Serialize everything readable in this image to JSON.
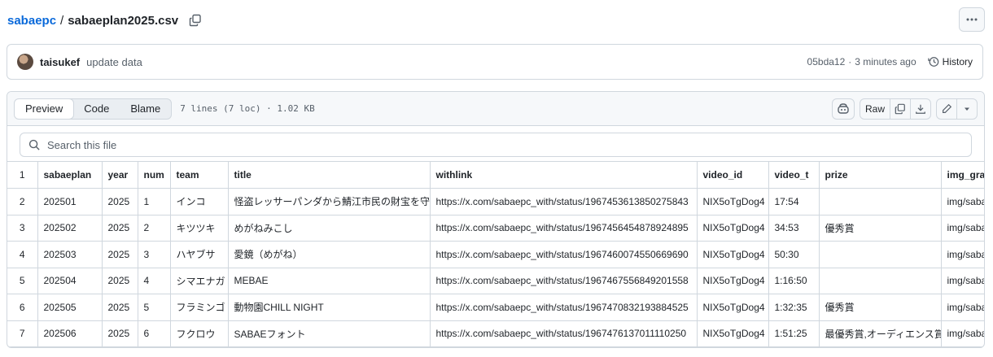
{
  "breadcrumb": {
    "repo": "sabaepc",
    "separator": "/",
    "file": "sabaeplan2025.csv"
  },
  "commit": {
    "author": "taisukef",
    "message": "update data",
    "sha": "05bda12",
    "dot": "·",
    "time": "3 minutes ago",
    "history_label": "History"
  },
  "file_header": {
    "tabs": [
      "Preview",
      "Code",
      "Blame"
    ],
    "active_tab": "Preview",
    "loc_info": "7 lines (7 loc) · 1.02 KB",
    "raw_label": "Raw"
  },
  "search": {
    "placeholder": "Search this file"
  },
  "table": {
    "header_line": "1",
    "columns": [
      "sabaeplan",
      "year",
      "num",
      "team",
      "title",
      "withlink",
      "video_id",
      "video_t",
      "prize",
      "img_grare"
    ],
    "rows": [
      {
        "line": "2",
        "cells": [
          "202501",
          "2025",
          "1",
          "インコ",
          "怪盗レッサーパンダから鯖江市民の財宝を守れ",
          "https://x.com/sabaepc_with/status/1967453613850275843",
          "NIX5oTgDog4",
          "17:54",
          "",
          "img/sabae"
        ]
      },
      {
        "line": "3",
        "cells": [
          "202502",
          "2025",
          "2",
          "キツツキ",
          "めがねみこし",
          "https://x.com/sabaepc_with/status/1967456454878924895",
          "NIX5oTgDog4",
          "34:53",
          "優秀賞",
          "img/sabae"
        ]
      },
      {
        "line": "4",
        "cells": [
          "202503",
          "2025",
          "3",
          "ハヤブサ",
          "愛鏡（めがね）",
          "https://x.com/sabaepc_with/status/1967460074550669690",
          "NIX5oTgDog4",
          "50:30",
          "",
          "img/sabae"
        ]
      },
      {
        "line": "5",
        "cells": [
          "202504",
          "2025",
          "4",
          "シマエナガ",
          "MEBAE",
          "https://x.com/sabaepc_with/status/1967467556849201558",
          "NIX5oTgDog4",
          "1:16:50",
          "",
          "img/sabae"
        ]
      },
      {
        "line": "6",
        "cells": [
          "202505",
          "2025",
          "5",
          "フラミンゴ",
          "動物園CHILL NIGHT",
          "https://x.com/sabaepc_with/status/1967470832193884525",
          "NIX5oTgDog4",
          "1:32:35",
          "優秀賞",
          "img/sabae"
        ]
      },
      {
        "line": "7",
        "cells": [
          "202506",
          "2025",
          "6",
          "フクロウ",
          "SABAEフォント",
          "https://x.com/sabaepc_with/status/1967476137011110250",
          "NIX5oTgDog4",
          "1:51:25",
          "最優秀賞,オーディエンス賞",
          "img/sabae"
        ]
      }
    ]
  }
}
